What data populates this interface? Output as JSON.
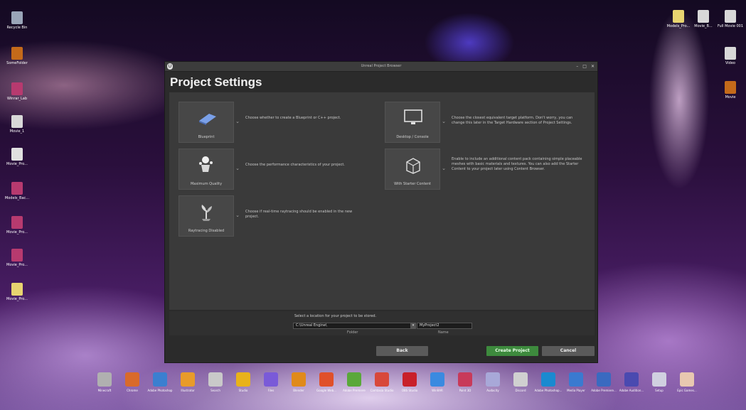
{
  "desktop_left": [
    {
      "label": "Recycle Bin",
      "icon": "recycle-bin-icon",
      "color": "#9aa5b8"
    },
    {
      "label": "SomeFolder",
      "icon": "app-icon",
      "color": "#c46a1a"
    },
    {
      "label": "Winrar_Lab",
      "icon": "winrar-icon",
      "color": "#b73a6f"
    },
    {
      "label": "Movie_1",
      "icon": "file-icon",
      "color": "#d8d8d8"
    },
    {
      "label": "Movie_Pro...",
      "icon": "file-icon",
      "color": "#e0e0e0"
    },
    {
      "label": "Models_Bac...",
      "icon": "winrar-icon",
      "color": "#b73a6f"
    },
    {
      "label": "Movie_Pro...",
      "icon": "winrar-icon",
      "color": "#b73a6f"
    },
    {
      "label": "Movie_Pro...",
      "icon": "winrar-icon",
      "color": "#b73a6f"
    },
    {
      "label": "Movie_Pro...",
      "icon": "file-icon",
      "color": "#e8d470"
    }
  ],
  "desktop_right": [
    {
      "label": "Models_Pro...",
      "icon": "folder-icon",
      "color": "#e8d470"
    },
    {
      "label": "Movie_B...",
      "icon": "file-icon",
      "color": "#d8d8d8"
    },
    {
      "label": "Full Movie 001",
      "icon": "file-icon",
      "color": "#d8d8d8"
    },
    {
      "label": "Video",
      "icon": "file-icon",
      "color": "#d8d8d8"
    },
    {
      "label": "Movie",
      "icon": "app-icon",
      "color": "#c46a1a"
    }
  ],
  "window": {
    "title": "Unreal Project Browser",
    "heading": "Project Settings",
    "minimize": "–",
    "maximize": "□",
    "close": "✕",
    "options_left": [
      {
        "tile": "Blueprint",
        "desc": "Choose whether to create a Blueprint or C++ project."
      },
      {
        "tile": "Maximum Quality",
        "desc": "Choose the performance characteristics of your project."
      },
      {
        "tile": "Raytracing Disabled",
        "desc": "Choose if real-time raytracing should be enabled in the new project."
      }
    ],
    "options_right": [
      {
        "tile": "Desktop / Console",
        "desc": "Choose the closest equivalent target platform. Don't worry, you can change this later in the Target Hardware section of Project Settings."
      },
      {
        "tile": "With Starter Content",
        "desc": "Enable to include an additional content pack containing simple placeable meshes with basic materials and textures. You can also add the Starter Content to your project later using Content Browser."
      }
    ],
    "location_label": "Select a location for your project to be stored.",
    "path_value": "C:\\Unreal Engine\\",
    "name_value": "MyProject2",
    "folder_sub": "Folder",
    "name_sub": "Name",
    "back": "Back",
    "create": "Create Project",
    "cancel": "Cancel"
  },
  "taskbar": [
    {
      "label": "Minecraft",
      "color": "#b0b0b0"
    },
    {
      "label": "Chrome",
      "color": "#d96a2a"
    },
    {
      "label": "Adobe Photoshop",
      "color": "#3b7fd0"
    },
    {
      "label": "Illustrator",
      "color": "#e89b2a"
    },
    {
      "label": "Search",
      "color": "#c9c9c9"
    },
    {
      "label": "Studio",
      "color": "#e8b21a"
    },
    {
      "label": "Files",
      "color": "#7a5ad8"
    },
    {
      "label": "Blender",
      "color": "#e08a1a"
    },
    {
      "label": "Google Web...",
      "color": "#e0502a"
    },
    {
      "label": "Adobe Premiere",
      "color": "#5aa83a"
    },
    {
      "label": "Camtasia Studio",
      "color": "#d8483a"
    },
    {
      "label": "OBS Studio",
      "color": "#c8202a"
    },
    {
      "label": "WinRAR",
      "color": "#3a8ae0"
    },
    {
      "label": "Paint 3D",
      "color": "#c83a5a"
    },
    {
      "label": "Audacity",
      "color": "#a8a8d8"
    },
    {
      "label": "Discord",
      "color": "#d0d0d0"
    },
    {
      "label": "Adobe Photoshop...",
      "color": "#1a8ad0"
    },
    {
      "label": "Media Player",
      "color": "#3a7ad0"
    },
    {
      "label": "Adobe Premiere...",
      "color": "#3a6ac0"
    },
    {
      "label": "Adobe Audition...",
      "color": "#4a4ab0"
    },
    {
      "label": "Setup",
      "color": "#d0d0e0"
    },
    {
      "label": "Epic Games...",
      "color": "#e8c8b0"
    }
  ]
}
